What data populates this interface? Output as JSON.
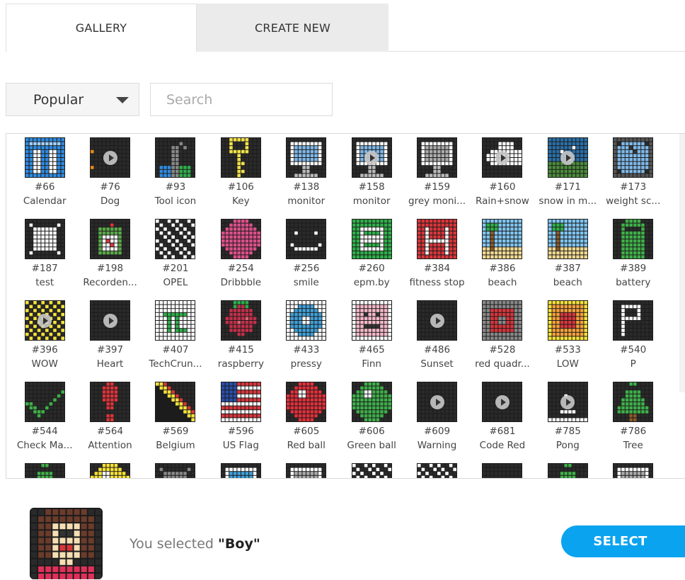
{
  "tabs": {
    "gallery": "GALLERY",
    "create_new": "CREATE NEW"
  },
  "filter": {
    "sort_value": "Popular",
    "search_placeholder": "Search"
  },
  "gallery": [
    {
      "num": "#66",
      "name": "Calendar",
      "icon": "calendar",
      "color": "#2f8be0",
      "play": false
    },
    {
      "num": "#76",
      "name": "Dog",
      "icon": "dog",
      "color": "#e08a1e",
      "play": true
    },
    {
      "num": "#93",
      "name": "Tool icon",
      "icon": "tool",
      "color": "#2f8be0",
      "play": false
    },
    {
      "num": "#106",
      "name": "Key",
      "icon": "key",
      "color": "#f2e24a",
      "play": false
    },
    {
      "num": "#138",
      "name": "monitor",
      "icon": "monitor",
      "color": "#7fb8e8",
      "play": false
    },
    {
      "num": "#158",
      "name": "monitor",
      "icon": "monitor",
      "color": "#7fb8e8",
      "play": true
    },
    {
      "num": "#159",
      "name": "grey moni...",
      "icon": "monitor",
      "color": "#aaaaaa",
      "play": false
    },
    {
      "num": "#160",
      "name": "Rain+snow",
      "icon": "cloud",
      "color": "#ffffff",
      "play": true
    },
    {
      "num": "#171",
      "name": "snow in m...",
      "icon": "landscape",
      "color": "#4b8b3b",
      "play": true
    },
    {
      "num": "#173",
      "name": "weight sc...",
      "icon": "scale",
      "color": "#7fb8e8",
      "play": false
    },
    {
      "num": "#187",
      "name": "test",
      "icon": "ring",
      "color": "#ffffff",
      "play": false
    },
    {
      "num": "#198",
      "name": "Recorden...",
      "icon": "recorden",
      "color": "#5aa84a",
      "play": false
    },
    {
      "num": "#201",
      "name": "OPEL",
      "icon": "opel",
      "color": "#ffffff",
      "play": false
    },
    {
      "num": "#254",
      "name": "Dribbble",
      "icon": "ball",
      "color": "#d9508a",
      "play": false
    },
    {
      "num": "#256",
      "name": "smile",
      "icon": "smile",
      "color": "#ffffff",
      "play": false
    },
    {
      "num": "#260",
      "name": "epm.by",
      "icon": "epm",
      "color": "#2fae4a",
      "play": false
    },
    {
      "num": "#384",
      "name": "fitness stop",
      "icon": "fitness",
      "color": "#d8353a",
      "play": false
    },
    {
      "num": "#386",
      "name": "beach",
      "icon": "beach",
      "color": "#3fa0d8",
      "play": false
    },
    {
      "num": "#387",
      "name": "beach",
      "icon": "beach",
      "color": "#3fa0d8",
      "play": false
    },
    {
      "num": "#389",
      "name": "battery",
      "icon": "battery",
      "color": "#3fae4a",
      "play": false
    },
    {
      "num": "#396",
      "name": "WOW",
      "icon": "checker",
      "color": "#f5e23a",
      "play": true
    },
    {
      "num": "#397",
      "name": "Heart",
      "icon": "blank",
      "color": "#1c1c1c",
      "play": true
    },
    {
      "num": "#407",
      "name": "TechCrun...",
      "icon": "tc",
      "color": "#2fae4a",
      "play": false
    },
    {
      "num": "#415",
      "name": "raspberry",
      "icon": "raspberry",
      "color": "#c0304a",
      "play": false
    },
    {
      "num": "#433",
      "name": "pressy",
      "icon": "pressy",
      "color": "#3fa0d8",
      "play": false
    },
    {
      "num": "#465",
      "name": "Finn",
      "icon": "finn",
      "color": "#f5b8c8",
      "play": false
    },
    {
      "num": "#486",
      "name": "Sunset",
      "icon": "blank",
      "color": "#f5e23a",
      "play": true
    },
    {
      "num": "#528",
      "name": "red quadr...",
      "icon": "redquad",
      "color": "#d8353a",
      "play": false
    },
    {
      "num": "#533",
      "name": "LOW",
      "icon": "low",
      "color": "#f5a03a",
      "play": false
    },
    {
      "num": "#540",
      "name": "P",
      "icon": "p",
      "color": "#ffffff",
      "play": false
    },
    {
      "num": "#544",
      "name": "Check Ma...",
      "icon": "check",
      "color": "#3fae4a",
      "play": false
    },
    {
      "num": "#564",
      "name": "Attention",
      "icon": "attention",
      "color": "#d8353a",
      "play": false
    },
    {
      "num": "#569",
      "name": "Belgium",
      "icon": "belgium",
      "color": "#f5e23a",
      "play": false
    },
    {
      "num": "#596",
      "name": "US Flag",
      "icon": "usflag",
      "color": "#d8353a",
      "play": false
    },
    {
      "num": "#605",
      "name": "Red ball",
      "icon": "disc",
      "color": "#e0303a",
      "play": false
    },
    {
      "num": "#606",
      "name": "Green ball",
      "icon": "disc",
      "color": "#3fae4a",
      "play": false
    },
    {
      "num": "#609",
      "name": "Warning",
      "icon": "blank",
      "color": "#1c1c1c",
      "play": true
    },
    {
      "num": "#681",
      "name": "Code Red",
      "icon": "blank",
      "color": "#1c1c1c",
      "play": true
    },
    {
      "num": "#785",
      "name": "Pong",
      "icon": "pong",
      "color": "#ffffff",
      "play": true
    },
    {
      "num": "#786",
      "name": "Tree",
      "icon": "tree",
      "color": "#3fae4a",
      "play": false
    },
    {
      "num": "",
      "name": "",
      "icon": "tree",
      "color": "#3fae4a",
      "play": false
    },
    {
      "num": "",
      "name": "",
      "icon": "disc",
      "color": "#f5e23a",
      "play": false
    },
    {
      "num": "",
      "name": "",
      "icon": "ring",
      "color": "#888888",
      "play": false
    },
    {
      "num": "",
      "name": "",
      "icon": "monitor",
      "color": "#3fa0d8",
      "play": false
    },
    {
      "num": "",
      "name": "",
      "icon": "monitor",
      "color": "#aaaaaa",
      "play": false
    },
    {
      "num": "",
      "name": "",
      "icon": "opel",
      "color": "#ffffff",
      "play": false
    },
    {
      "num": "",
      "name": "",
      "icon": "opel",
      "color": "#ffffff",
      "play": false
    },
    {
      "num": "",
      "name": "",
      "icon": "blank",
      "color": "#1c1c1c",
      "play": false
    },
    {
      "num": "",
      "name": "",
      "icon": "tree",
      "color": "#3fae4a",
      "play": false
    },
    {
      "num": "",
      "name": "",
      "icon": "monitor",
      "color": "#aaaaaa",
      "play": false
    }
  ],
  "selection": {
    "prefix": "You selected ",
    "name": "\"Boy\"",
    "button": "SELECT"
  }
}
